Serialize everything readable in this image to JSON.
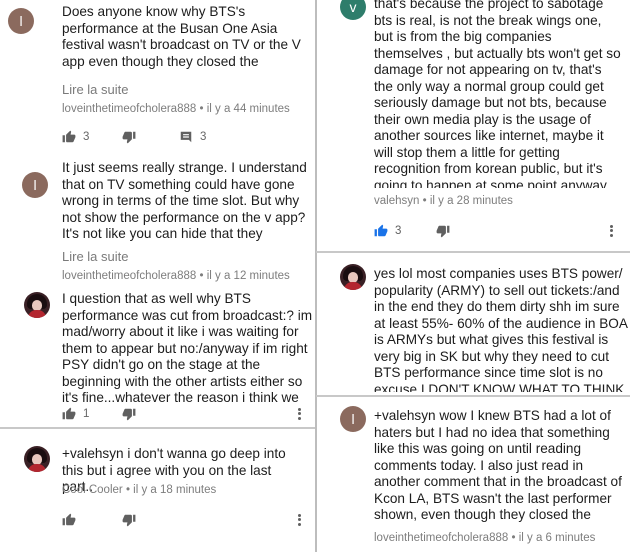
{
  "left": {
    "comments": [
      {
        "avatar_letter": "l",
        "text": "Does anyone know why BTS's performance at the Busan One Asia festival wasn't broadcast on TV or the V app even though they closed the festival? They weren't even allowed to go out on stage with all the other",
        "read_more": "Lire la suite",
        "author": "loveinthetimeofcholera888",
        "time": "il y a 44 minutes",
        "likes": "3",
        "replies": "3"
      },
      {
        "avatar_letter": "l",
        "text": "It just seems really strange. I understand that on TV something could have gone wrong in terms of the time slot. But why not show the performance on the v app? It's not like you can hide that they performed.",
        "read_more": "Lire la suite",
        "author": "loveinthetimeofcholera888",
        "time": "il y a 12 minutes"
      },
      {
        "text": "I question that as well why BTS performance was cut from broadcast:? im mad/worry about it like i was waiting for them to appear but no:/anyway if im right PSY didn't go on the stage at the beginning with the other artists either so it's fine...whatever the reason i think we won't know",
        "likes": "1"
      },
      {
        "text": "+valehsyn i don't wanna go deep into this but i agree with you on the last part..",
        "author": "Cool Cooler",
        "time": "il y a 18 minutes"
      }
    ]
  },
  "right": {
    "comments": [
      {
        "avatar_letter": "v",
        "text": "that's because the project to sabotage bts is real, is not the break wings one, but is from the big companies themselves , but actually  bts won't get so damage for not appearing on tv, that's the only way a normal group could get seriously damage but not bts, because their own media play is the usage of another sources like internet, maybe it will stop them a little for getting recognition from korean public, but it's going to happen at some point anyway. right know they are using bts for selling and then they just banned them.",
        "author": "valehsyn",
        "time": "il y a 28 minutes",
        "likes": "3"
      },
      {
        "text": "yes lol most companies uses BTS power/ popularity (ARMY) to sell out tickets:/and in the end they do them dirty shh im sure at least 55%- 60% of the audience in BOA is ARMYs but what gives this festival is very big in SK but why they need to cut BTS performance since time slot is no excuse I DON'T KNOW WHAT TO THINK ANYMORE :("
      },
      {
        "avatar_letter": "l",
        "text": "+valehsyn wow I knew BTS had a lot of haters but I had no idea that something like this was going on until reading comments today. I also just read in another comment that in the broadcast of Kcon LA, BTS wasn't the last performer shown, even though they closed the show. But I can't confirm that since I only watched fancams.",
        "author": "loveinthetimeofcholera888",
        "time": "il y a 6 minutes"
      }
    ]
  },
  "separator": "•",
  "colors": {
    "like_active": "#1a73e8",
    "icon": "#606060",
    "meta": "#7d7d7d"
  }
}
